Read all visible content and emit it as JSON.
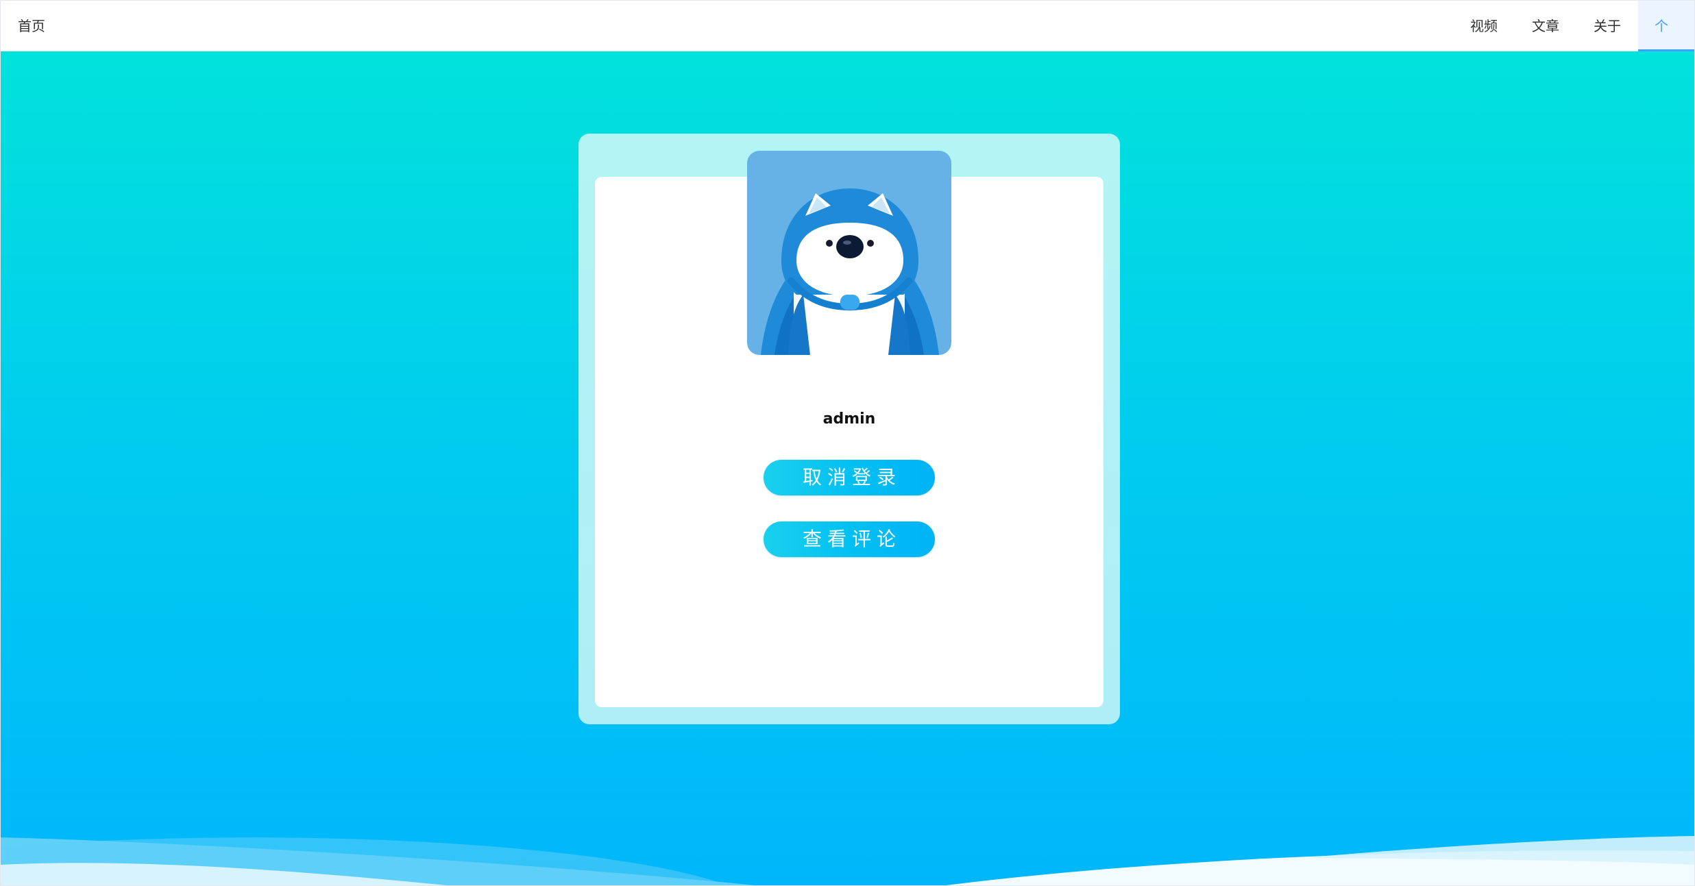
{
  "nav": {
    "home_label": "首页",
    "items": [
      {
        "label": "视频"
      },
      {
        "label": "文章"
      },
      {
        "label": "关于"
      },
      {
        "label": "个人"
      }
    ],
    "active_index": 3
  },
  "profile": {
    "avatar_icon": "husky-hoodie-avatar",
    "username": "admin",
    "logout_label": "取消登录",
    "comments_label": "查看评论"
  },
  "colors": {
    "accent": "#409eff",
    "background_top": "#02e2dc",
    "background_bottom": "#00b6fb",
    "button": "#02c0f2",
    "card_frame": "#b3f4f4"
  }
}
